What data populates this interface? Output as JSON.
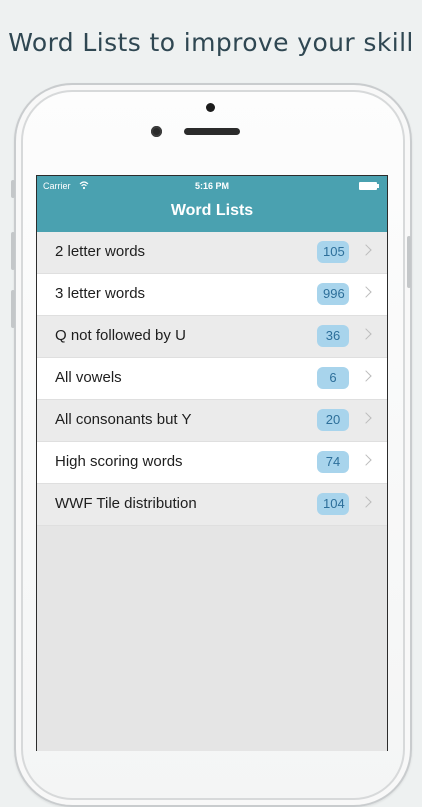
{
  "promo": {
    "headline": "Word Lists to improve your skill"
  },
  "status_bar": {
    "carrier": "Carrier",
    "time": "5:16 PM"
  },
  "nav": {
    "title": "Word Lists"
  },
  "colors": {
    "navbar": "#4aa1b0",
    "badge_bg": "#a8d4ec",
    "badge_text": "#2d6f9a"
  },
  "list": [
    {
      "label": "2 letter words",
      "count": "105"
    },
    {
      "label": "3 letter words",
      "count": "996"
    },
    {
      "label": "Q not followed by U",
      "count": "36"
    },
    {
      "label": "All vowels",
      "count": "6"
    },
    {
      "label": "All consonants but Y",
      "count": "20"
    },
    {
      "label": "High scoring words",
      "count": "74"
    },
    {
      "label": "WWF Tile distribution",
      "count": "104"
    }
  ],
  "icons": [
    "wifi-icon",
    "battery-icon",
    "chevron-right-icon"
  ]
}
